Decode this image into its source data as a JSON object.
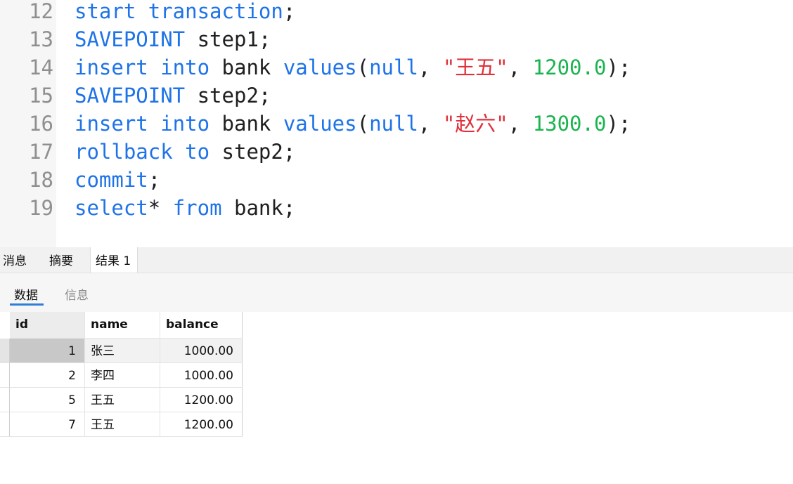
{
  "editor": {
    "lines": [
      {
        "num": "12",
        "tokens": [
          {
            "t": "start transaction",
            "c": "kw"
          },
          {
            "t": ";",
            "c": "plain"
          }
        ]
      },
      {
        "num": "13",
        "tokens": [
          {
            "t": "SAVEPOINT",
            "c": "kw"
          },
          {
            "t": " step1;",
            "c": "plain"
          }
        ]
      },
      {
        "num": "14",
        "tokens": [
          {
            "t": "insert into",
            "c": "kw"
          },
          {
            "t": " bank ",
            "c": "plain"
          },
          {
            "t": "values",
            "c": "kw"
          },
          {
            "t": "(",
            "c": "plain"
          },
          {
            "t": "null",
            "c": "kw"
          },
          {
            "t": ", ",
            "c": "plain"
          },
          {
            "t": "\"王五\"",
            "c": "str"
          },
          {
            "t": ", ",
            "c": "plain"
          },
          {
            "t": "1200.0",
            "c": "num"
          },
          {
            "t": ");",
            "c": "plain"
          }
        ]
      },
      {
        "num": "15",
        "tokens": [
          {
            "t": "SAVEPOINT",
            "c": "kw"
          },
          {
            "t": " step2;",
            "c": "plain"
          }
        ]
      },
      {
        "num": "16",
        "tokens": [
          {
            "t": "insert into",
            "c": "kw"
          },
          {
            "t": " bank ",
            "c": "plain"
          },
          {
            "t": "values",
            "c": "kw"
          },
          {
            "t": "(",
            "c": "plain"
          },
          {
            "t": "null",
            "c": "kw"
          },
          {
            "t": ", ",
            "c": "plain"
          },
          {
            "t": "\"赵六\"",
            "c": "str"
          },
          {
            "t": ", ",
            "c": "plain"
          },
          {
            "t": "1300.0",
            "c": "num"
          },
          {
            "t": ");",
            "c": "plain"
          }
        ]
      },
      {
        "num": "17",
        "tokens": [
          {
            "t": "rollback to",
            "c": "kw"
          },
          {
            "t": " step2;",
            "c": "plain"
          }
        ]
      },
      {
        "num": "18",
        "tokens": [
          {
            "t": "commit",
            "c": "kw"
          },
          {
            "t": ";",
            "c": "plain"
          }
        ]
      },
      {
        "num": "19",
        "tokens": [
          {
            "t": "select",
            "c": "kw"
          },
          {
            "t": "* ",
            "c": "plain"
          },
          {
            "t": "from",
            "c": "kw"
          },
          {
            "t": " bank;",
            "c": "plain"
          }
        ]
      }
    ]
  },
  "result_tabs": {
    "messages": "消息",
    "summary": "摘要",
    "result1": "结果 1"
  },
  "sub_tabs": {
    "data": "数据",
    "info": "信息"
  },
  "grid": {
    "columns": [
      "id",
      "name",
      "balance"
    ],
    "rows": [
      {
        "id": "1",
        "name": "张三",
        "balance": "1000.00"
      },
      {
        "id": "2",
        "name": "李四",
        "balance": "1000.00"
      },
      {
        "id": "5",
        "name": "王五",
        "balance": "1200.00"
      },
      {
        "id": "7",
        "name": "王五",
        "balance": "1200.00"
      }
    ]
  },
  "colors": {
    "keyword": "#1e73e8",
    "string": "#e0303a",
    "number": "#1ab44f",
    "plain": "#1f1f1f",
    "line_number": "#8f8f8f",
    "tab_underline": "#2f7fd6"
  }
}
